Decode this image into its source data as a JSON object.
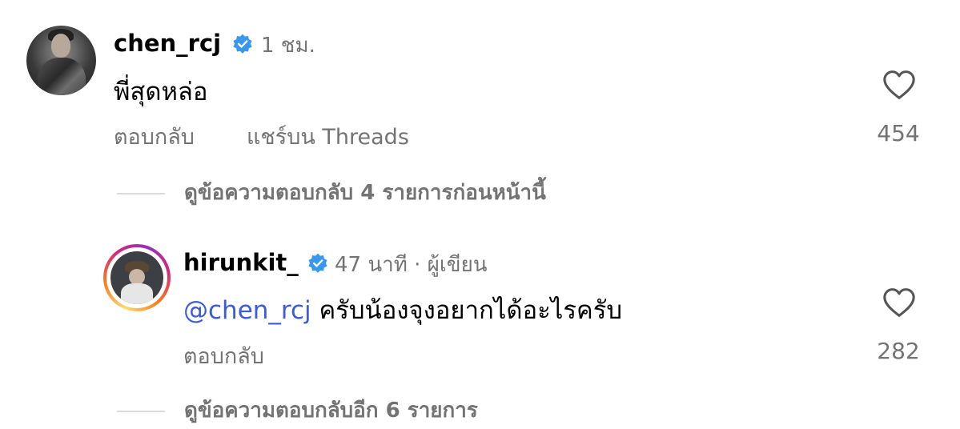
{
  "comments": [
    {
      "username": "chen_rcj",
      "verified": true,
      "timestamp": "1 ชม.",
      "text": "พี่สุดหล่อ",
      "actions": {
        "reply": "ตอบกลับ",
        "share": "แชร์บน Threads"
      },
      "like_count": "454",
      "view_previous_replies": "ดูข้อความตอบกลับ 4 รายการก่อนหน้านี้",
      "avatar_icon": "profile-photo"
    }
  ],
  "reply": {
    "username": "hirunkit_",
    "verified": true,
    "timestamp": "47 นาที",
    "separator": "·",
    "author_badge": "ผู้เขียน",
    "mention": "@chen_rcj",
    "text": " ครับน้องจุงอยากได้อะไรครับ",
    "actions": {
      "reply": "ตอบกลับ"
    },
    "like_count": "282",
    "avatar_icon": "profile-photo-with-story-ring"
  },
  "view_more_replies": "ดูข้อความตอบกลับอีก 6 รายการ",
  "colors": {
    "verified_badge": "#3897f0",
    "mention": "#3b5bdb",
    "secondary_text": "#737373",
    "thread_line": "#dbdbdb"
  }
}
